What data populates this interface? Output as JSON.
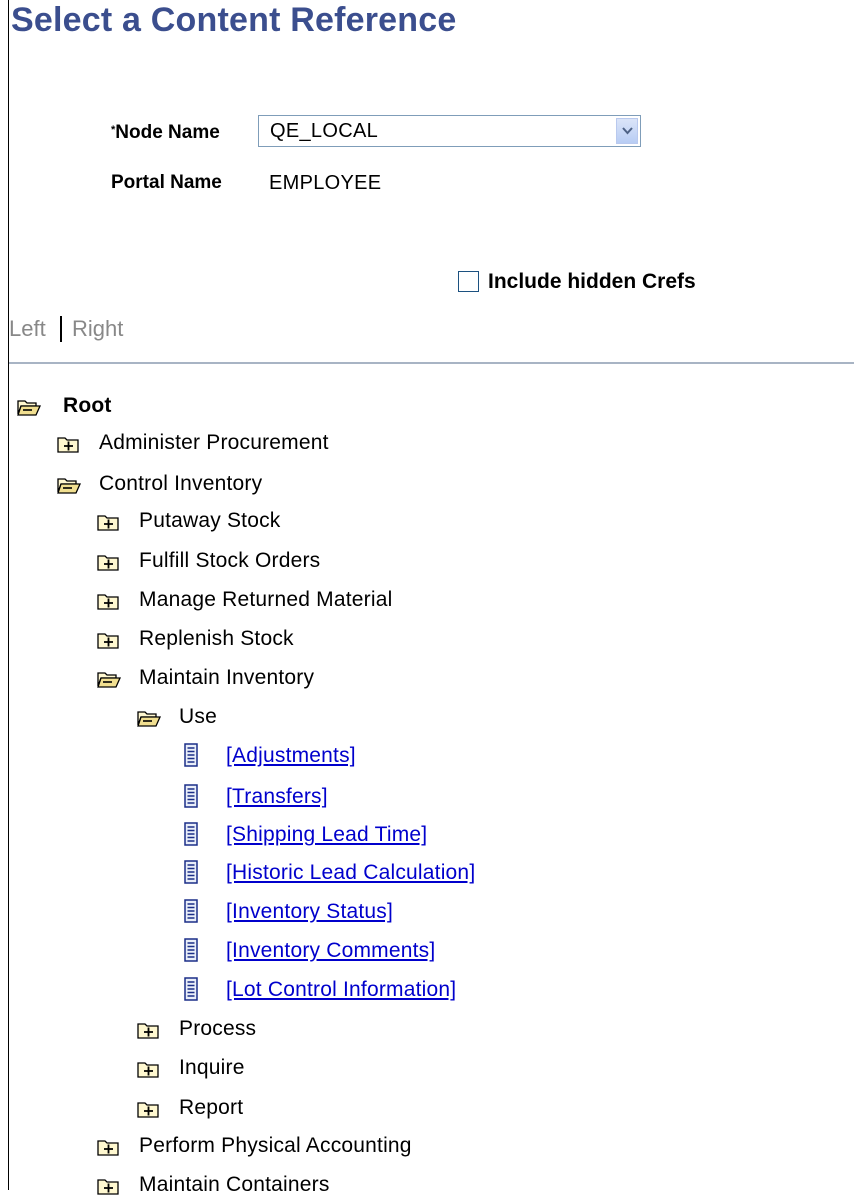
{
  "page": {
    "title": "Select a Content Reference"
  },
  "form": {
    "node_name_required": "*",
    "node_name_label": "Node Name",
    "node_name_value": "QE_LOCAL",
    "portal_name_label": "Portal Name",
    "portal_name_value": "EMPLOYEE",
    "include_hidden_label": "Include hidden Crefs",
    "include_hidden_checked": false
  },
  "nav": {
    "left": "Left",
    "right": "Right"
  },
  "tree": [
    {
      "label": "Root",
      "depth": 0,
      "type": "folder-open",
      "bold": true
    },
    {
      "label": "Administer Procurement",
      "depth": 1,
      "type": "folder-closed"
    },
    {
      "label": "Control Inventory",
      "depth": 1,
      "type": "folder-open"
    },
    {
      "label": "Putaway Stock",
      "depth": 2,
      "type": "folder-closed"
    },
    {
      "label": "Fulfill Stock Orders",
      "depth": 2,
      "type": "folder-closed"
    },
    {
      "label": "Manage Returned Material",
      "depth": 2,
      "type": "folder-closed"
    },
    {
      "label": "Replenish Stock",
      "depth": 2,
      "type": "folder-closed"
    },
    {
      "label": "Maintain Inventory",
      "depth": 2,
      "type": "folder-open"
    },
    {
      "label": "Use",
      "depth": 3,
      "type": "folder-open"
    },
    {
      "label": "[Adjustments]",
      "depth": 4,
      "type": "leaf"
    },
    {
      "label": "[Transfers]",
      "depth": 4,
      "type": "leaf"
    },
    {
      "label": "[Shipping Lead Time]",
      "depth": 4,
      "type": "leaf"
    },
    {
      "label": "[Historic Lead Calculation]",
      "depth": 4,
      "type": "leaf"
    },
    {
      "label": "[Inventory Status]",
      "depth": 4,
      "type": "leaf"
    },
    {
      "label": "[Inventory Comments]",
      "depth": 4,
      "type": "leaf"
    },
    {
      "label": "[Lot Control Information]",
      "depth": 4,
      "type": "leaf"
    },
    {
      "label": "Process",
      "depth": 3,
      "type": "folder-closed"
    },
    {
      "label": "Inquire",
      "depth": 3,
      "type": "folder-closed"
    },
    {
      "label": "Report",
      "depth": 3,
      "type": "folder-closed"
    },
    {
      "label": "Perform Physical Accounting",
      "depth": 2,
      "type": "folder-closed"
    },
    {
      "label": "Maintain Containers",
      "depth": 2,
      "type": "folder-closed"
    }
  ]
}
